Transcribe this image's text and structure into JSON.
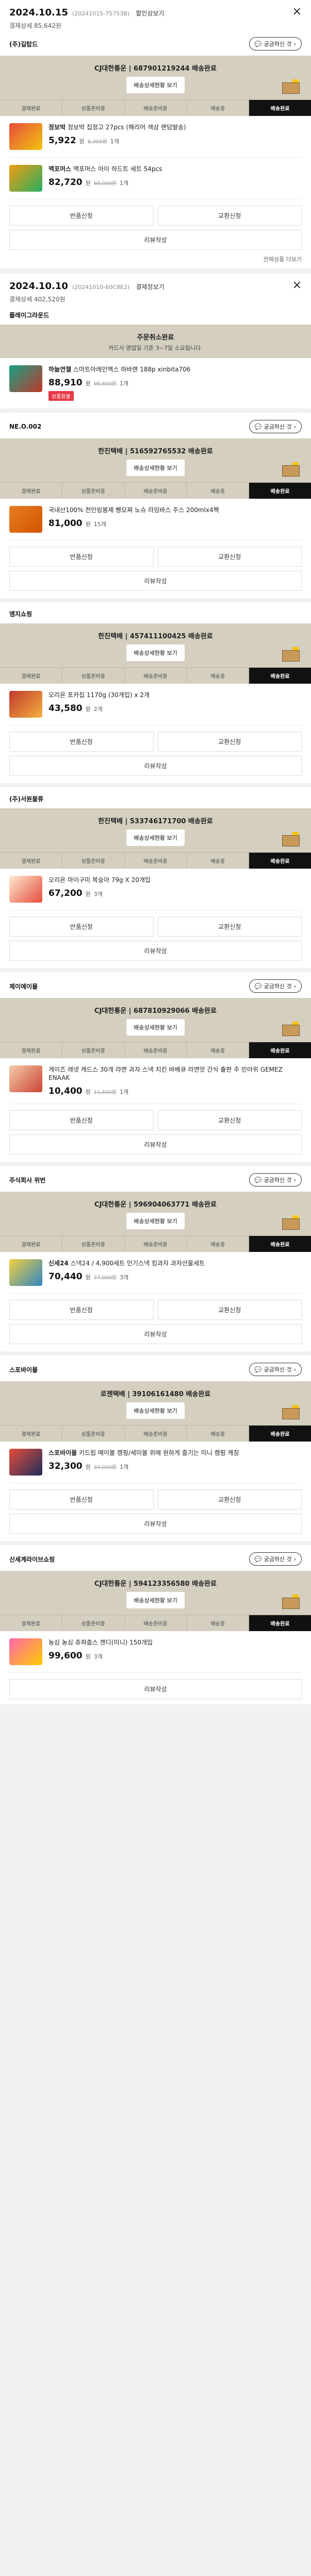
{
  "colors": {
    "band": "#d4cfbf",
    "active_step": "#111111",
    "badge": "#e63946"
  },
  "steps": [
    "결제완료",
    "상품준비중",
    "배송준비중",
    "배송중",
    "배송완료"
  ],
  "labels": {
    "status_btn": "배송상세현황 보기",
    "return": "반품신청",
    "exchange": "교환신청",
    "review": "리뷰작성",
    "pill": "궁금하신 것",
    "won": "원",
    "more_link": "전체상품 더보기"
  },
  "orders": [
    {
      "date": "2024.10.15",
      "no": "(2024101S-75753B)",
      "detail": "할인상보기",
      "sub": "결제상세 85,642원",
      "sellers": [
        {
          "name": "(주)길탑드",
          "carrier": "CJ대한통운 | 687901219244 배송완료",
          "note": "",
          "items": [
            {
              "brand": "정보박",
              "name": "정보박 집정고 27pcs (해리어 색상 랜덤발송)",
              "price": "5,922",
              "orig": "6,300원",
              "qty": "1개",
              "badge": ""
            },
            {
              "brand": "맥포머스",
              "name": "맥포머스 아이 하드트 세트 54pcs",
              "price": "82,720",
              "orig": "88,000원",
              "qty": "1개",
              "badge": ""
            }
          ]
        }
      ]
    },
    {
      "date": "2024.10.10",
      "no": "(20241010-60C8E2)",
      "detail": "결제정보기",
      "sub": "결제상세 402,520원",
      "sellers": [
        {
          "name": "플레이그라운드",
          "carrier": "주문취소완료",
          "note": "카드사 영업일 기준 3~7일 소요됩니다.",
          "items": [
            {
              "brand": "하늘연챌",
              "name": "스마트아레인맥스 하바랜 188p xinbita706",
              "price": "88,910",
              "orig": "95,600원",
              "qty": "1개",
              "badge": "상품환불"
            }
          ]
        },
        {
          "name": "NE.O.002",
          "carrier": "한진택배 | 516592765532 배송완료",
          "note": "",
          "items": [
            {
              "brand": "",
              "name": "국내산100% 전인링봉제 빵모찌 노슈 라임바스 주스 200mlx4팩",
              "price": "81,000",
              "orig": "",
              "qty": "15개",
              "badge": ""
            }
          ]
        },
        {
          "name": "엠지쇼핑",
          "carrier": "한진택배 | 457411100425 배송완료",
          "note": "",
          "items": [
            {
              "brand": "",
              "name": "오리온 포카칩 1170g (30개입) x 2개",
              "price": "43,580",
              "orig": "",
              "qty": "2개",
              "badge": ""
            }
          ]
        },
        {
          "name": "(주)서원물류",
          "carrier": "한진택배 | 533746171700 배송완료",
          "note": "",
          "items": [
            {
              "brand": "",
              "name": "오리온 마이구미 복숭아 79g X 20개입",
              "price": "67,200",
              "orig": "",
              "qty": "3개",
              "badge": ""
            }
          ]
        },
        {
          "name": "제이에이몰",
          "carrier": "CJ대한통운 | 687810929066 배송완료",
          "note": "",
          "items": [
            {
              "brand": "",
              "name": "게이즈 레넷 캐드스 30개 라면 과자 스낵 치킨 바베큐 라면맛 간식 출판 주 민아위 GEMEZ ENAAK",
              "price": "10,400",
              "orig": "11,600원",
              "qty": "1개",
              "badge": ""
            }
          ]
        },
        {
          "name": "주식회사 위번",
          "carrier": "CJ대한통운 | 596904063771 배송완료",
          "note": "",
          "items": [
            {
              "brand": "신세24",
              "name": "스낵24 / 4,900세트 인기스낵 킹과자 과자선물세트",
              "price": "70,440",
              "orig": "77,000원",
              "qty": "3개",
              "badge": ""
            }
          ]
        },
        {
          "name": "스포바이몰",
          "carrier": "로젠택배 | 39106161480 배송완료",
          "note": "",
          "items": [
            {
              "brand": "스포바이몰",
              "name": "키드립 메이볼 캠핑/세미볼 위에 원하게 즐기는 미니 캠핑 캐칭",
              "price": "32,300",
              "orig": "34,000원",
              "qty": "1개",
              "badge": ""
            }
          ]
        },
        {
          "name": "신세계라이브쇼핑",
          "carrier": "CJ대한통운 | 594123356580 배송완료",
          "note": "",
          "items": [
            {
              "brand": "",
              "name": "농심 농심 츄파춥스 캔디(미니) 150개입",
              "price": "99,600",
              "orig": "",
              "qty": "3개",
              "badge": ""
            }
          ]
        }
      ]
    }
  ]
}
